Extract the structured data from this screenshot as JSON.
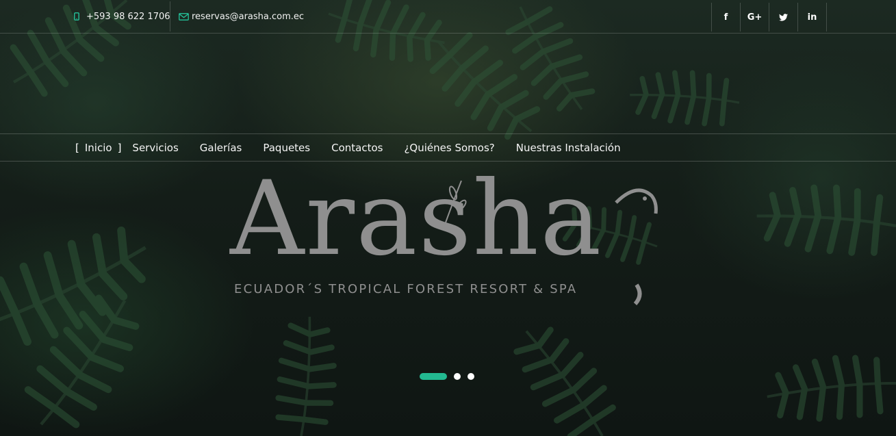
{
  "topbar": {
    "phone": "+593 98 622 1706",
    "phone_icon": "mobile-phone-icon",
    "email": "reservas@arasha.com.ec",
    "email_icon": "envelope-icon",
    "social": [
      {
        "name": "facebook",
        "glyph": "f"
      },
      {
        "name": "google-plus",
        "glyph": "G+"
      },
      {
        "name": "twitter",
        "glyph": "t"
      },
      {
        "name": "linkedin",
        "glyph": "in"
      }
    ]
  },
  "nav": {
    "open_bracket": "[",
    "close_bracket": "]",
    "items": [
      "Inicio",
      "Servicios",
      "Galerías",
      "Paquetes",
      "Contactos",
      "¿Quiénes Somos?",
      "Nuestras Instalación"
    ],
    "active_index": 0
  },
  "hero": {
    "logo_text": "Arasha",
    "tagline": "ECUADOR´S TROPICAL FOREST RESORT & SPA",
    "slides_total": 3,
    "active_slide": 1
  },
  "colors": {
    "accent": "#23b991",
    "logo": "#8f8f8f",
    "background": "#121a16"
  }
}
